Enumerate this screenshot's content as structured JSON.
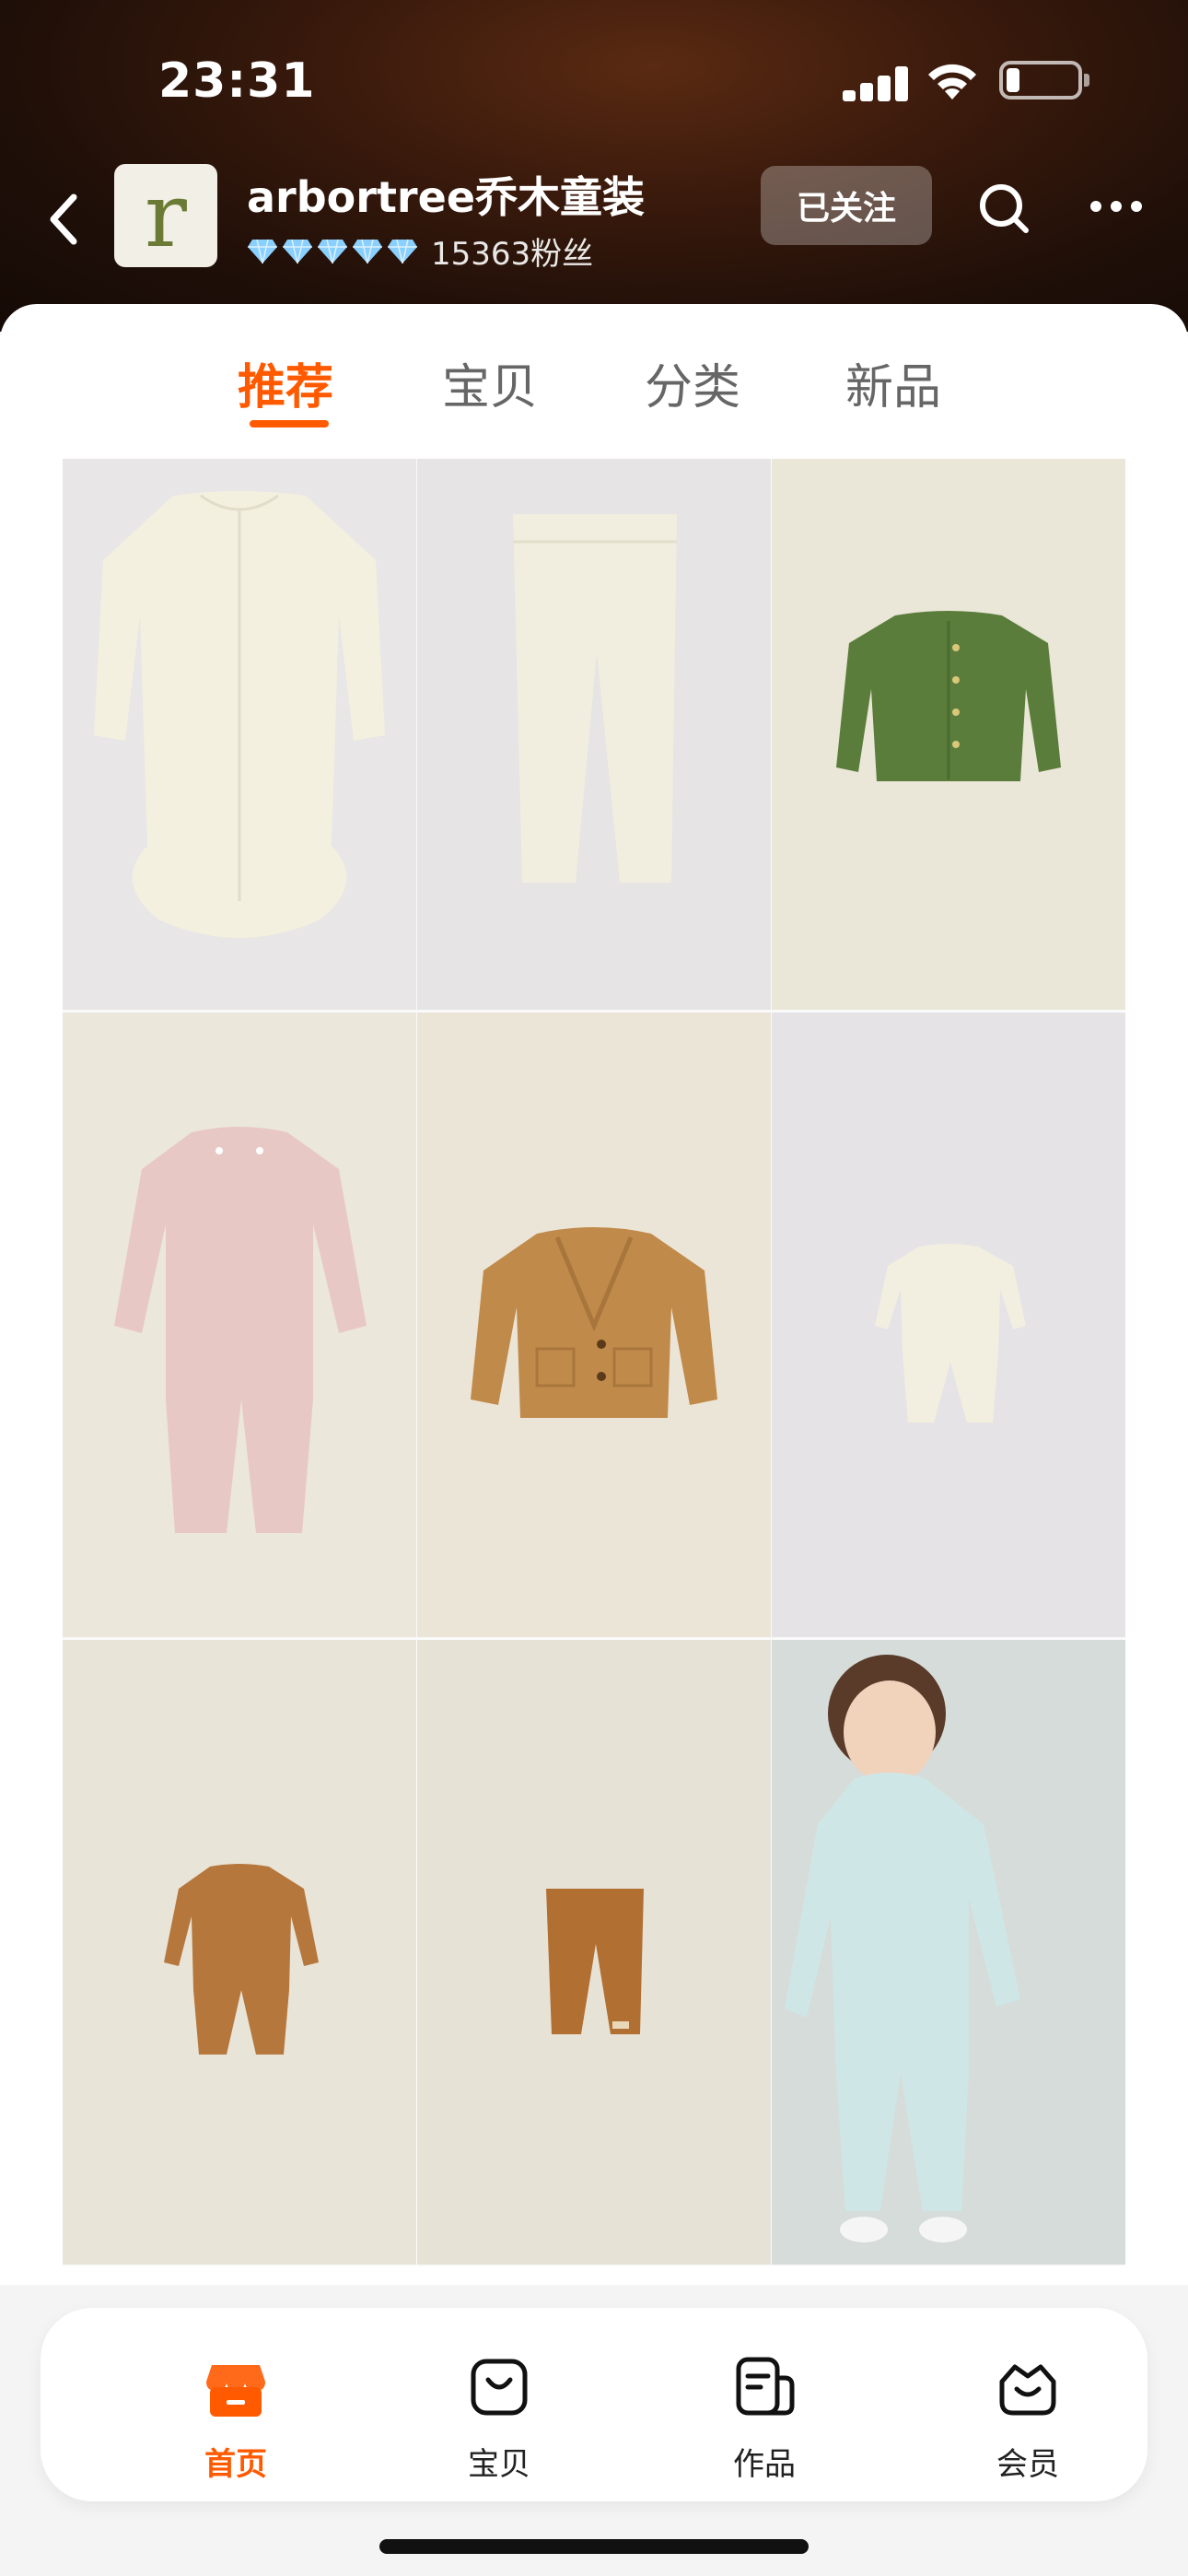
{
  "status_bar": {
    "time": "23:31"
  },
  "store": {
    "avatar_letter": "r",
    "name": "arbortree乔木童装",
    "fans": "15363粉丝",
    "follow_label": "已关注",
    "diamond_count": 5
  },
  "tabs": [
    {
      "label": "推荐",
      "active": true
    },
    {
      "label": "宝贝",
      "active": false
    },
    {
      "label": "分类",
      "active": false
    },
    {
      "label": "新品",
      "active": false
    }
  ],
  "products": [
    {
      "item": "cream long-sleeve bodysuit",
      "bg": "#e8e6e7"
    },
    {
      "item": "cream knit leggings",
      "bg": "#e6e4e4"
    },
    {
      "item": "green button cardigan",
      "bg": "#ebe7d8"
    },
    {
      "item": "pink knit romper",
      "bg": "#ece7db"
    },
    {
      "item": "tan shawl-collar cardigan",
      "bg": "#ebe5d7"
    },
    {
      "item": "cream small romper",
      "bg": "#e5e3e6"
    },
    {
      "item": "brown romper",
      "bg": "#e9e4d8"
    },
    {
      "item": "brown leggings",
      "bg": "#e7e2d6"
    },
    {
      "item": "toddler in mint romper",
      "bg": "#d6dcd9"
    }
  ],
  "bottom_nav": [
    {
      "label": "首页",
      "icon": "shop-home-icon",
      "active": true
    },
    {
      "label": "宝贝",
      "icon": "bag-icon",
      "active": false
    },
    {
      "label": "作品",
      "icon": "works-icon",
      "active": false
    },
    {
      "label": "会员",
      "icon": "member-basket-icon",
      "active": false
    }
  ],
  "colors": {
    "accent": "#ff5a00",
    "header_dark": "#1f0f08",
    "diamond": "#8ad0ff"
  }
}
